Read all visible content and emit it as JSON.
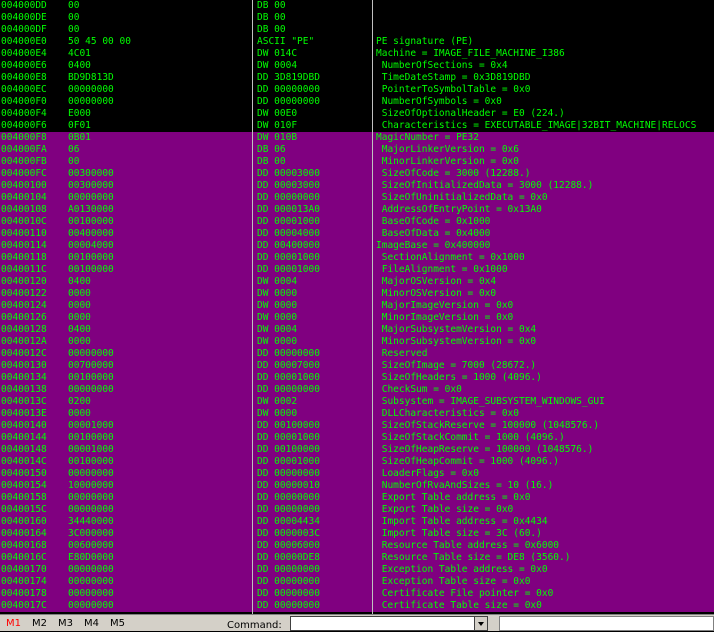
{
  "colors": {
    "header_bg": "#000000",
    "optional_header_bg": "#800080",
    "text": "#00ff00",
    "active_tab": "#ff0000"
  },
  "rows": [
    {
      "addr": "004000DD",
      "hex": "00",
      "disasm": "DB 00",
      "comment": "",
      "bg": "black"
    },
    {
      "addr": "004000DE",
      "hex": "00",
      "disasm": "DB 00",
      "comment": "",
      "bg": "black"
    },
    {
      "addr": "004000DF",
      "hex": "00",
      "disasm": "DB 00",
      "comment": "",
      "bg": "black"
    },
    {
      "addr": "004000E0",
      "hex": "50 45 00 00",
      "disasm": "ASCII \"PE\"",
      "comment": "PE signature (PE)",
      "bg": "black"
    },
    {
      "addr": "004000E4",
      "hex": "4C01",
      "disasm": "DW 014C",
      "comment": "Machine = IMAGE_FILE_MACHINE_I386",
      "bg": "black"
    },
    {
      "addr": "004000E6",
      "hex": "0400",
      "disasm": "DW 0004",
      "comment": " NumberOfSections = 0x4",
      "bg": "black"
    },
    {
      "addr": "004000E8",
      "hex": "BD9D813D",
      "disasm": "DD 3D819DBD",
      "comment": " TimeDateStamp = 0x3D819DBD",
      "bg": "black"
    },
    {
      "addr": "004000EC",
      "hex": "00000000",
      "disasm": "DD 00000000",
      "comment": " PointerToSymbolTable = 0x0",
      "bg": "black"
    },
    {
      "addr": "004000F0",
      "hex": "00000000",
      "disasm": "DD 00000000",
      "comment": " NumberOfSymbols = 0x0",
      "bg": "black"
    },
    {
      "addr": "004000F4",
      "hex": "E000",
      "disasm": "DW 00E0",
      "comment": " SizeOfOptionalHeader = E0 (224.)",
      "bg": "black"
    },
    {
      "addr": "004000F6",
      "hex": "0F01",
      "disasm": "DW 010F",
      "comment": " Characteristics = EXECUTABLE_IMAGE|32BIT_MACHINE|RELOCS",
      "bg": "black"
    },
    {
      "addr": "004000F8",
      "hex": "0B01",
      "disasm": "DW 010B",
      "comment": "MagicNumber = PE32",
      "bg": "purple"
    },
    {
      "addr": "004000FA",
      "hex": "06",
      "disasm": "DB 06",
      "comment": " MajorLinkerVersion = 0x6",
      "bg": "purple"
    },
    {
      "addr": "004000FB",
      "hex": "00",
      "disasm": "DB 00",
      "comment": " MinorLinkerVersion = 0x0",
      "bg": "purple"
    },
    {
      "addr": "004000FC",
      "hex": "00300000",
      "disasm": "DD 00003000",
      "comment": " SizeOfCode = 3000 (12288.)",
      "bg": "purple"
    },
    {
      "addr": "00400100",
      "hex": "00300000",
      "disasm": "DD 00003000",
      "comment": " SizeOfInitializedData = 3000 (12288.)",
      "bg": "purple"
    },
    {
      "addr": "00400104",
      "hex": "00000000",
      "disasm": "DD 00000000",
      "comment": " SizeOfUninitializedData = 0x0",
      "bg": "purple"
    },
    {
      "addr": "00400108",
      "hex": "A0130000",
      "disasm": "DD 000013A0",
      "comment": " AddressOfEntryPoint = 0x13A0",
      "bg": "purple"
    },
    {
      "addr": "0040010C",
      "hex": "00100000",
      "disasm": "DD 00001000",
      "comment": " BaseOfCode = 0x1000",
      "bg": "purple"
    },
    {
      "addr": "00400110",
      "hex": "00400000",
      "disasm": "DD 00004000",
      "comment": " BaseOfData = 0x4000",
      "bg": "purple"
    },
    {
      "addr": "00400114",
      "hex": "00004000",
      "disasm": "DD 00400000",
      "comment": "ImageBase = 0x400000",
      "bg": "purple"
    },
    {
      "addr": "00400118",
      "hex": "00100000",
      "disasm": "DD 00001000",
      "comment": " SectionAlignment = 0x1000",
      "bg": "purple"
    },
    {
      "addr": "0040011C",
      "hex": "00100000",
      "disasm": "DD 00001000",
      "comment": " FileAlignment = 0x1000",
      "bg": "purple"
    },
    {
      "addr": "00400120",
      "hex": "0400",
      "disasm": "DW 0004",
      "comment": " MajorOSVersion = 0x4",
      "bg": "purple"
    },
    {
      "addr": "00400122",
      "hex": "0000",
      "disasm": "DW 0000",
      "comment": " MinorOSVersion = 0x0",
      "bg": "purple"
    },
    {
      "addr": "00400124",
      "hex": "0000",
      "disasm": "DW 0000",
      "comment": " MajorImageVersion = 0x0",
      "bg": "purple"
    },
    {
      "addr": "00400126",
      "hex": "0000",
      "disasm": "DW 0000",
      "comment": " MinorImageVersion = 0x0",
      "bg": "purple"
    },
    {
      "addr": "00400128",
      "hex": "0400",
      "disasm": "DW 0004",
      "comment": " MajorSubsystemVersion = 0x4",
      "bg": "purple"
    },
    {
      "addr": "0040012A",
      "hex": "0000",
      "disasm": "DW 0000",
      "comment": " MinorSubsystemVersion = 0x0",
      "bg": "purple"
    },
    {
      "addr": "0040012C",
      "hex": "00000000",
      "disasm": "DD 00000000",
      "comment": " Reserved",
      "bg": "purple"
    },
    {
      "addr": "00400130",
      "hex": "00700000",
      "disasm": "DD 00007000",
      "comment": " SizeOfImage = 7000 (28672.)",
      "bg": "purple"
    },
    {
      "addr": "00400134",
      "hex": "00100000",
      "disasm": "DD 00001000",
      "comment": " SizeOfHeaders = 1000 (4096.)",
      "bg": "purple"
    },
    {
      "addr": "00400138",
      "hex": "00000000",
      "disasm": "DD 00000000",
      "comment": " CheckSum = 0x0",
      "bg": "purple"
    },
    {
      "addr": "0040013C",
      "hex": "0200",
      "disasm": "DW 0002",
      "comment": " Subsystem = IMAGE_SUBSYSTEM_WINDOWS_GUI",
      "bg": "purple"
    },
    {
      "addr": "0040013E",
      "hex": "0000",
      "disasm": "DW 0000",
      "comment": " DLLCharacteristics = 0x0",
      "bg": "purple"
    },
    {
      "addr": "00400140",
      "hex": "00001000",
      "disasm": "DD 00100000",
      "comment": " SizeOfStackReserve = 100000 (1048576.)",
      "bg": "purple"
    },
    {
      "addr": "00400144",
      "hex": "00100000",
      "disasm": "DD 00001000",
      "comment": " SizeOfStackCommit = 1000 (4096.)",
      "bg": "purple"
    },
    {
      "addr": "00400148",
      "hex": "00001000",
      "disasm": "DD 00100000",
      "comment": " SizeOfHeapReserve = 100000 (1048576.)",
      "bg": "purple"
    },
    {
      "addr": "0040014C",
      "hex": "00100000",
      "disasm": "DD 00001000",
      "comment": " SizeOfHeapCommit = 1000 (4096.)",
      "bg": "purple"
    },
    {
      "addr": "00400150",
      "hex": "00000000",
      "disasm": "DD 00000000",
      "comment": " LoaderFlags = 0x0",
      "bg": "purple"
    },
    {
      "addr": "00400154",
      "hex": "10000000",
      "disasm": "DD 00000010",
      "comment": " NumberOfRvaAndSizes = 10 (16.)",
      "bg": "purple"
    },
    {
      "addr": "00400158",
      "hex": "00000000",
      "disasm": "DD 00000000",
      "comment": " Export Table address = 0x0",
      "bg": "purple"
    },
    {
      "addr": "0040015C",
      "hex": "00000000",
      "disasm": "DD 00000000",
      "comment": " Export Table size = 0x0",
      "bg": "purple"
    },
    {
      "addr": "00400160",
      "hex": "34440000",
      "disasm": "DD 00004434",
      "comment": " Import Table address = 0x4434",
      "bg": "purple"
    },
    {
      "addr": "00400164",
      "hex": "3C000000",
      "disasm": "DD 0000003C",
      "comment": " Import Table size = 3C (60.)",
      "bg": "purple"
    },
    {
      "addr": "00400168",
      "hex": "00600000",
      "disasm": "DD 00006000",
      "comment": " Resource Table address = 0x6000",
      "bg": "purple"
    },
    {
      "addr": "0040016C",
      "hex": "E80D0000",
      "disasm": "DD 00000DE8",
      "comment": " Resource Table size = DE8 (3560.)",
      "bg": "purple"
    },
    {
      "addr": "00400170",
      "hex": "00000000",
      "disasm": "DD 00000000",
      "comment": " Exception Table address = 0x0",
      "bg": "purple"
    },
    {
      "addr": "00400174",
      "hex": "00000000",
      "disasm": "DD 00000000",
      "comment": " Exception Table size = 0x0",
      "bg": "purple"
    },
    {
      "addr": "00400178",
      "hex": "00000000",
      "disasm": "DD 00000000",
      "comment": " Certificate File pointer = 0x0",
      "bg": "purple"
    },
    {
      "addr": "0040017C",
      "hex": "00000000",
      "disasm": "DD 00000000",
      "comment": " Certificate Table size = 0x0",
      "bg": "purple"
    }
  ],
  "bottom_bar": {
    "tabs": [
      "M1",
      "M2",
      "M3",
      "M4",
      "M5"
    ],
    "active_tab": "M1",
    "command_label": "Command:",
    "command_value": ""
  }
}
